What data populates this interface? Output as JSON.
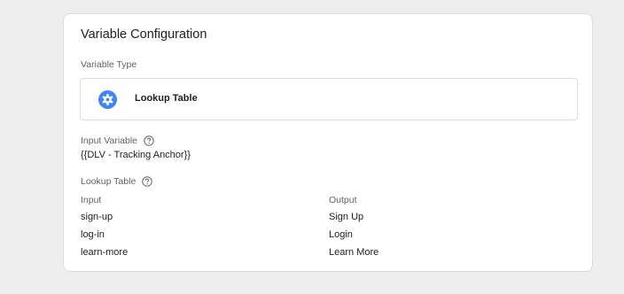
{
  "card": {
    "title": "Variable Configuration",
    "variable_type_label": "Variable Type",
    "variable_type": {
      "name": "Lookup Table",
      "icon": "gear-icon",
      "icon_color": "#4285f4"
    },
    "input_variable_label": "Input Variable",
    "input_variable_value": "{{DLV - Tracking Anchor}}",
    "lookup_table_label": "Lookup Table",
    "help_icon": "help-circle-icon",
    "table": {
      "headers": [
        "Input",
        "Output"
      ],
      "rows": [
        [
          "sign-up",
          "Sign Up"
        ],
        [
          "log-in",
          "Login"
        ],
        [
          "learn-more",
          "Learn More"
        ]
      ]
    }
  }
}
